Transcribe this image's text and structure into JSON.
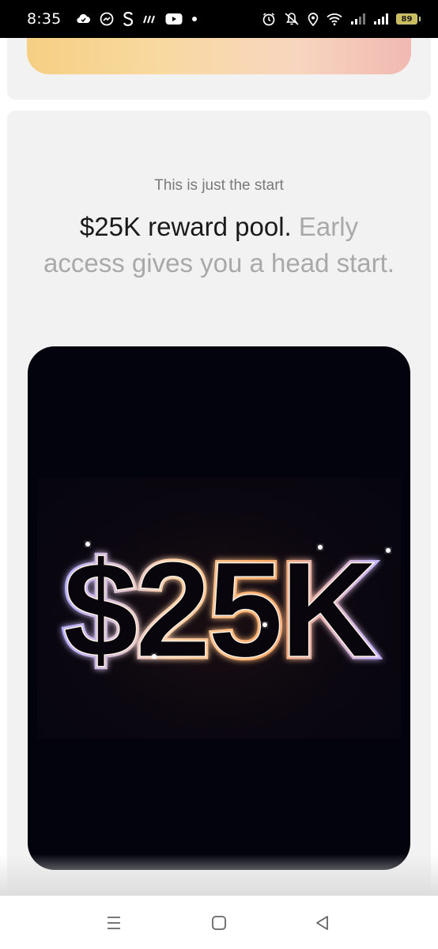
{
  "status_bar": {
    "time": "8:35",
    "battery_level": "89",
    "left_icons": [
      "cloud-icon",
      "messenger-icon",
      "s-app-icon",
      "wavy-app-icon",
      "youtube-icon",
      "dot-icon"
    ],
    "right_icons": [
      "alarm-icon",
      "mute-icon",
      "location-icon",
      "wifi-icon",
      "signal-icon",
      "signal-icon",
      "battery-icon"
    ]
  },
  "section": {
    "eyebrow": "This is just the start",
    "headline_strong": "$25K reward pool.",
    "headline_rest": " Early access gives you a head start."
  },
  "promo": {
    "glow_text": "$25K",
    "colors": {
      "background": "#03030e",
      "glow_warm": "#ffb070",
      "glow_cool": "#a8a0ff"
    }
  },
  "nav_bar": {
    "icons": [
      "menu-icon",
      "home-icon",
      "back-icon"
    ]
  },
  "colors": {
    "card_bg": "#f2f2f2",
    "headline_dark": "#1a1a1a",
    "headline_muted": "#a9a9a9",
    "eyebrow": "#7a7a7a"
  }
}
